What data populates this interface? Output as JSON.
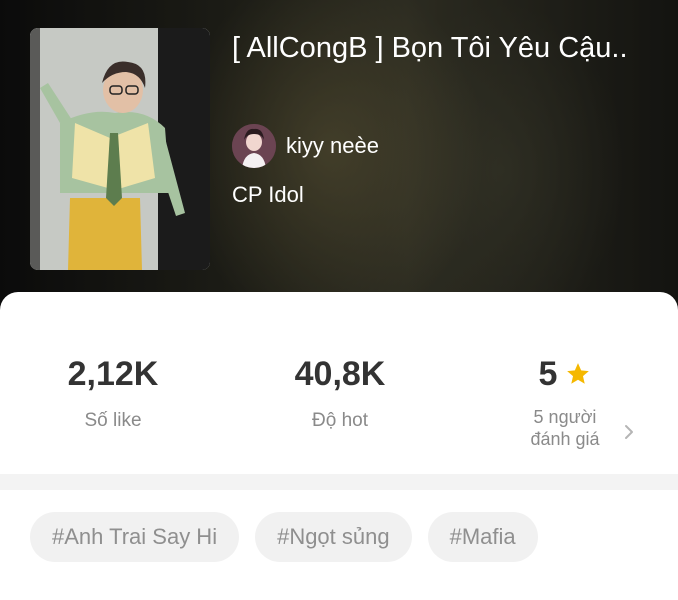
{
  "story": {
    "title": "[ AllCongB ] Bọn Tôi Yêu Cậu..",
    "author": "kiyy neèe",
    "category": "CP Idol"
  },
  "stats": {
    "likes": {
      "value": "2,12K",
      "label": "Số like"
    },
    "hot": {
      "value": "40,8K",
      "label": "Độ hot"
    },
    "rating": {
      "value": "5",
      "label_line1": "5 người",
      "label_line2": "đánh giá"
    }
  },
  "tags": [
    "#Anh Trai Say Hi",
    "#Ngọt sủng",
    "#Mafia"
  ],
  "icons": {
    "rating": "star-icon",
    "rating_more": "chevron-right-icon"
  },
  "colors": {
    "star": "#F5B800",
    "tag_bg": "#F1F1F1",
    "tag_text": "#8F8F8F"
  }
}
